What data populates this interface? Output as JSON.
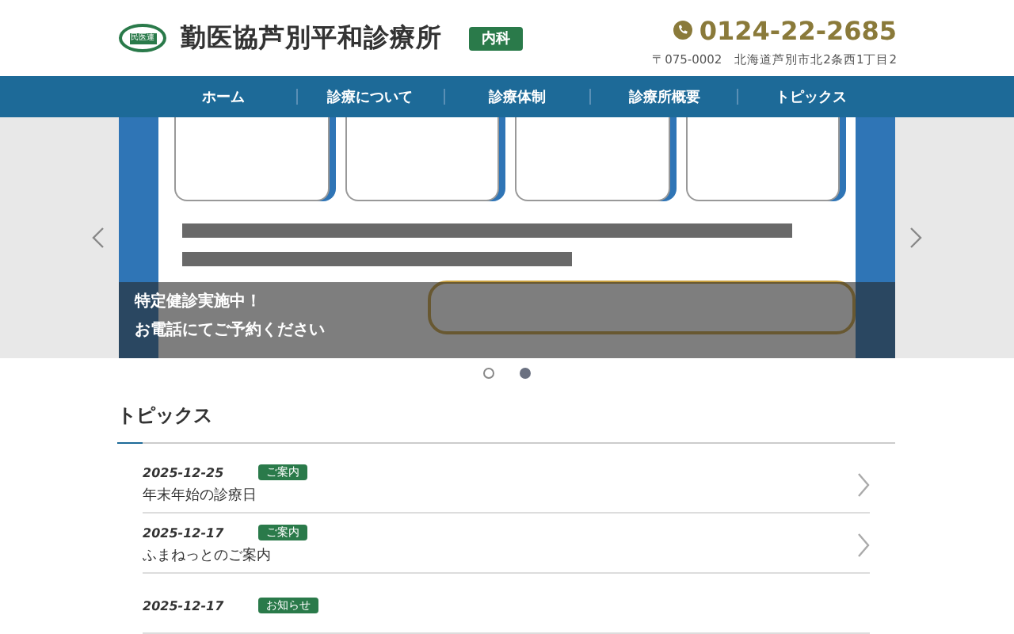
{
  "header": {
    "logo_text": "民医連",
    "clinic_name": "勤医協芦別平和診療所",
    "department_badge": "内科",
    "phone": "0124-22-2685",
    "address": "〒075-0002　北海道芦別市北2条西1丁目2"
  },
  "nav": [
    {
      "label": "ホーム"
    },
    {
      "label": "診療について"
    },
    {
      "label": "診療体制"
    },
    {
      "label": "診療所概要"
    },
    {
      "label": "トピックス"
    }
  ],
  "slider": {
    "caption_lines": [
      "特定健診実施中！",
      "お電話にてご予約ください"
    ],
    "dots": [
      {
        "selected": false
      },
      {
        "selected": true
      }
    ]
  },
  "topics": {
    "title": "トピックス",
    "items": [
      {
        "date": "2025-12-25",
        "badge": "ご案内",
        "title": "年末年始の診療日"
      },
      {
        "date": "2025-12-17",
        "badge": "ご案内",
        "title": "ふまねっとのご案内"
      },
      {
        "date": "2025-12-17",
        "badge": "お知らせ"
      }
    ]
  }
}
